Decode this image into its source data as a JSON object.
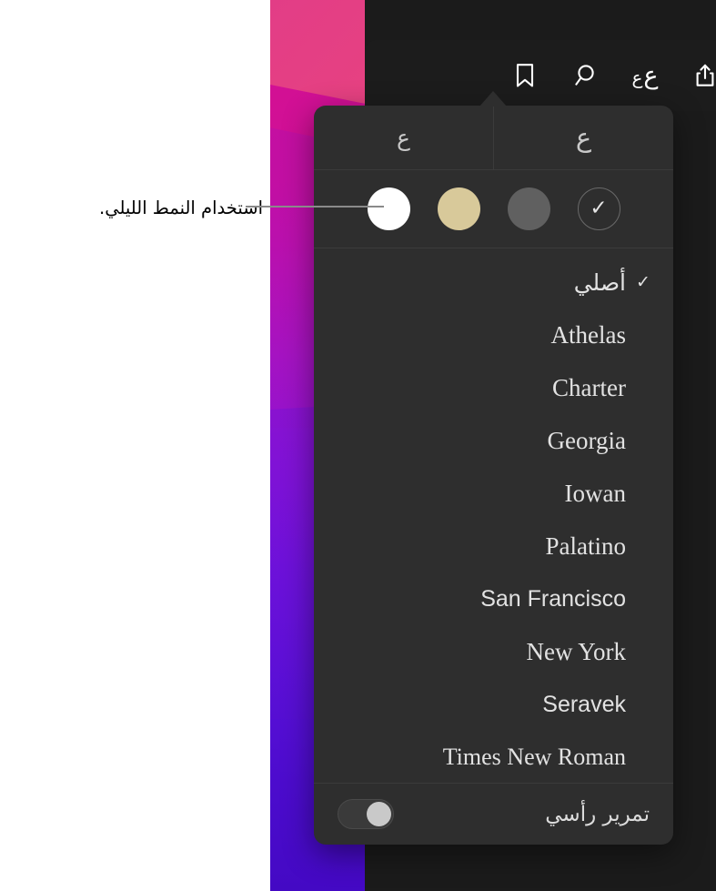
{
  "annotation": {
    "text": "استخدام النمط الليلي."
  },
  "toolbar": {
    "icons": [
      {
        "name": "bookmark-icon",
        "label": ""
      },
      {
        "name": "search-icon",
        "label": ""
      },
      {
        "name": "font-size-icon",
        "big": "ع",
        "small": "ع"
      },
      {
        "name": "share-icon",
        "label": ""
      }
    ]
  },
  "popover": {
    "size_controls": {
      "decrease_label": "ع",
      "increase_label": "ع"
    },
    "themes": [
      {
        "name": "theme-dark",
        "color": "#2e2e2e",
        "selected": true,
        "check": "✓"
      },
      {
        "name": "theme-gray",
        "color": "#606060",
        "selected": false
      },
      {
        "name": "theme-sepia",
        "color": "#d8c99a",
        "selected": false
      },
      {
        "name": "theme-light",
        "color": "#ffffff",
        "selected": false
      }
    ],
    "fonts": [
      {
        "label": "أصلي",
        "style": "f-arabic",
        "selected": true,
        "check": "✓"
      },
      {
        "label": "Athelas",
        "style": "f-serif",
        "selected": false
      },
      {
        "label": "Charter",
        "style": "f-serif",
        "selected": false
      },
      {
        "label": "Georgia",
        "style": "f-serif",
        "selected": false
      },
      {
        "label": "Iowan",
        "style": "f-serif",
        "selected": false
      },
      {
        "label": "Palatino",
        "style": "f-serif",
        "selected": false
      },
      {
        "label": "San Francisco",
        "style": "f-sans",
        "selected": false
      },
      {
        "label": "New York",
        "style": "f-serif",
        "selected": false
      },
      {
        "label": "Seravek",
        "style": "f-sans",
        "selected": false
      },
      {
        "label": "Times New Roman",
        "style": "f-times",
        "selected": false
      }
    ],
    "scroll_toggle": {
      "label": "تمرير رأسي",
      "on": false
    }
  }
}
